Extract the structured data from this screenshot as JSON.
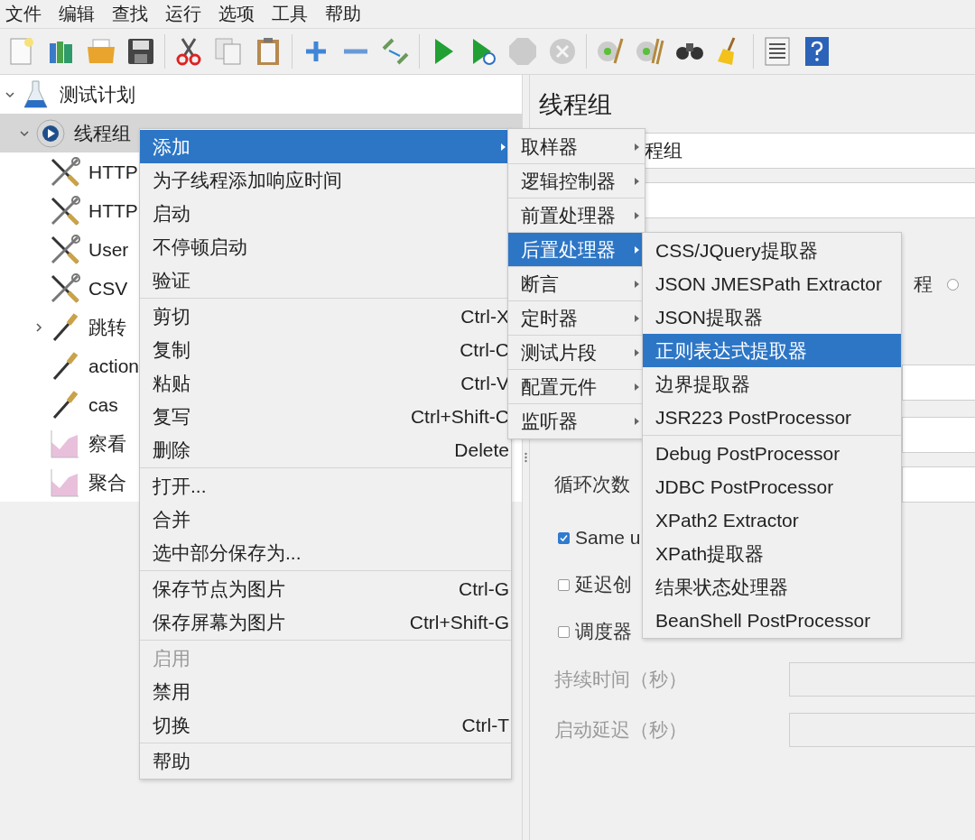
{
  "menu_bar": [
    "文件",
    "编辑",
    "查找",
    "运行",
    "选项",
    "工具",
    "帮助"
  ],
  "toolbar": [
    {
      "kind": "new",
      "disabled": false
    },
    {
      "kind": "templates",
      "disabled": false
    },
    {
      "kind": "open",
      "disabled": false
    },
    {
      "kind": "save",
      "disabled": false
    },
    {
      "kind": "separator"
    },
    {
      "kind": "cut",
      "disabled": false
    },
    {
      "kind": "copy",
      "disabled": false
    },
    {
      "kind": "paste",
      "disabled": false
    },
    {
      "kind": "separator"
    },
    {
      "kind": "expand",
      "disabled": false
    },
    {
      "kind": "collapse",
      "disabled": false
    },
    {
      "kind": "toggle",
      "disabled": false
    },
    {
      "kind": "separator"
    },
    {
      "kind": "start",
      "disabled": false
    },
    {
      "kind": "start-no-timers",
      "disabled": false
    },
    {
      "kind": "stop",
      "disabled": true
    },
    {
      "kind": "shutdown",
      "disabled": true
    },
    {
      "kind": "separator"
    },
    {
      "kind": "clear",
      "disabled": false
    },
    {
      "kind": "clear-all",
      "disabled": false
    },
    {
      "kind": "search",
      "disabled": false
    },
    {
      "kind": "reset-search",
      "disabled": false
    },
    {
      "kind": "separator"
    },
    {
      "kind": "log",
      "disabled": false
    },
    {
      "kind": "help",
      "disabled": false
    }
  ],
  "tree": [
    {
      "label": "测试计划",
      "kind": "plan",
      "expanded": true,
      "selected": false,
      "children": [
        {
          "label": "线程组",
          "kind": "thread-group",
          "expanded": true,
          "selected": true,
          "children": [
            {
              "label": "HTTP",
              "kind": "config",
              "selected": false
            },
            {
              "label": "HTTP",
              "kind": "config",
              "selected": false
            },
            {
              "label": "User",
              "kind": "config",
              "selected": false
            },
            {
              "label": "CSV",
              "kind": "config",
              "selected": false
            },
            {
              "label": "跳转",
              "kind": "sampler",
              "expanded": false,
              "selected": false
            },
            {
              "label": "action",
              "kind": "sampler",
              "selected": false
            },
            {
              "label": "cas",
              "kind": "sampler",
              "selected": false
            },
            {
              "label": "察看",
              "kind": "listener",
              "selected": false
            },
            {
              "label": "聚合",
              "kind": "listener",
              "selected": false
            }
          ]
        }
      ]
    }
  ],
  "panel": {
    "title": "线程组",
    "name_value": "程组",
    "radio": {
      "label": "程",
      "selected": false
    },
    "loops_label": "循环次数",
    "checkboxes": [
      {
        "label": "Same u",
        "checked": true
      },
      {
        "label": "延迟创",
        "checked": false
      },
      {
        "label": "调度器",
        "checked": false
      }
    ],
    "timing": [
      {
        "label": "持续时间（秒）",
        "disabled": true
      },
      {
        "label": "启动延迟（秒）",
        "disabled": true
      }
    ]
  },
  "context_menu": {
    "items": [
      {
        "kind": "item",
        "label": "添加",
        "submenu": true,
        "selected": true,
        "disabled": false
      },
      {
        "kind": "item",
        "label": "为子线程添加响应时间",
        "submenu": false,
        "selected": false,
        "disabled": false
      },
      {
        "kind": "item",
        "label": "启动",
        "submenu": false,
        "selected": false,
        "disabled": false
      },
      {
        "kind": "item",
        "label": "不停顿启动",
        "submenu": false,
        "selected": false,
        "disabled": false
      },
      {
        "kind": "item",
        "label": "验证",
        "submenu": false,
        "selected": false,
        "disabled": false
      },
      {
        "kind": "separator"
      },
      {
        "kind": "item",
        "label": "剪切",
        "shortcut": "Ctrl-X",
        "submenu": false,
        "selected": false,
        "disabled": false
      },
      {
        "kind": "item",
        "label": "复制",
        "shortcut": "Ctrl-C",
        "submenu": false,
        "selected": false,
        "disabled": false
      },
      {
        "kind": "item",
        "label": "粘贴",
        "shortcut": "Ctrl-V",
        "submenu": false,
        "selected": false,
        "disabled": false
      },
      {
        "kind": "item",
        "label": "复写",
        "shortcut": "Ctrl+Shift-C",
        "submenu": false,
        "selected": false,
        "disabled": false
      },
      {
        "kind": "item",
        "label": "删除",
        "shortcut": "Delete",
        "submenu": false,
        "selected": false,
        "disabled": false
      },
      {
        "kind": "separator"
      },
      {
        "kind": "item",
        "label": "打开...",
        "submenu": false,
        "selected": false,
        "disabled": false
      },
      {
        "kind": "item",
        "label": "合并",
        "submenu": false,
        "selected": false,
        "disabled": false
      },
      {
        "kind": "item",
        "label": "选中部分保存为...",
        "submenu": false,
        "selected": false,
        "disabled": false
      },
      {
        "kind": "separator"
      },
      {
        "kind": "item",
        "label": "保存节点为图片",
        "shortcut": "Ctrl-G",
        "submenu": false,
        "selected": false,
        "disabled": false
      },
      {
        "kind": "item",
        "label": "保存屏幕为图片",
        "shortcut": "Ctrl+Shift-G",
        "submenu": false,
        "selected": false,
        "disabled": false
      },
      {
        "kind": "separator"
      },
      {
        "kind": "item",
        "label": "启用",
        "submenu": false,
        "selected": false,
        "disabled": true
      },
      {
        "kind": "item",
        "label": "禁用",
        "submenu": false,
        "selected": false,
        "disabled": false
      },
      {
        "kind": "item",
        "label": "切换",
        "shortcut": "Ctrl-T",
        "submenu": false,
        "selected": false,
        "disabled": false
      },
      {
        "kind": "separator"
      },
      {
        "kind": "item",
        "label": "帮助",
        "submenu": false,
        "selected": false,
        "disabled": false
      }
    ]
  },
  "add_submenu": {
    "items": [
      {
        "label": "取样器",
        "selected": false
      },
      {
        "label": "逻辑控制器",
        "selected": false
      },
      {
        "label": "前置处理器",
        "selected": false
      },
      {
        "label": "后置处理器",
        "selected": true
      },
      {
        "label": "断言",
        "selected": false
      },
      {
        "label": "定时器",
        "selected": false
      },
      {
        "label": "测试片段",
        "selected": false
      },
      {
        "label": "配置元件",
        "selected": false
      },
      {
        "label": "监听器",
        "selected": false
      }
    ]
  },
  "post_processor_submenu": {
    "items": [
      {
        "kind": "item",
        "label": "CSS/JQuery提取器",
        "selected": false
      },
      {
        "kind": "item",
        "label": "JSON JMESPath Extractor",
        "selected": false
      },
      {
        "kind": "item",
        "label": "JSON提取器",
        "selected": false
      },
      {
        "kind": "item",
        "label": "正则表达式提取器",
        "selected": true
      },
      {
        "kind": "item",
        "label": "边界提取器",
        "selected": false
      },
      {
        "kind": "item",
        "label": "JSR223 PostProcessor",
        "selected": false
      },
      {
        "kind": "separator"
      },
      {
        "kind": "item",
        "label": "Debug PostProcessor",
        "selected": false
      },
      {
        "kind": "item",
        "label": "JDBC PostProcessor",
        "selected": false
      },
      {
        "kind": "item",
        "label": "XPath2 Extractor",
        "selected": false
      },
      {
        "kind": "item",
        "label": "XPath提取器",
        "selected": false
      },
      {
        "kind": "item",
        "label": "结果状态处理器",
        "selected": false
      },
      {
        "kind": "item",
        "label": "BeanShell PostProcessor",
        "selected": false
      }
    ]
  }
}
